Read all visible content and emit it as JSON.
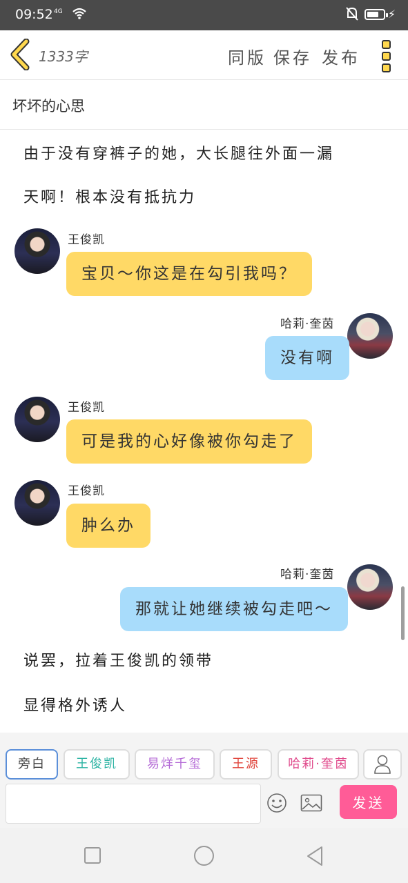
{
  "status_bar": {
    "time": "09:52",
    "signal": "4G",
    "icons": [
      "signal-icon",
      "wifi-icon",
      "mute-icon",
      "battery-icon"
    ]
  },
  "header": {
    "word_count": "1333字",
    "actions": [
      "同版",
      "保存",
      "发布"
    ]
  },
  "story": {
    "title": "坏坏的心思"
  },
  "content": {
    "narration_1": "由于没有穿裤子的她，大长腿往外面一漏",
    "narration_2": "天啊！根本没有抵抗力",
    "messages": [
      {
        "speaker": "王俊凯",
        "text": "宝贝～你这是在勾引我吗？",
        "side": "left"
      },
      {
        "speaker": "哈莉·奎茵",
        "text": "没有啊",
        "side": "right"
      },
      {
        "speaker": "王俊凯",
        "text": "可是我的心好像被你勾走了",
        "side": "left"
      },
      {
        "speaker": "王俊凯",
        "text": "肿么办",
        "side": "left"
      },
      {
        "speaker": "哈莉·奎茵",
        "text": "那就让她继续被勾走吧～",
        "side": "right"
      }
    ],
    "narration_3": "说罢，拉着王俊凯的领带",
    "narration_4": "显得格外诱人"
  },
  "composer": {
    "roles": [
      "旁白",
      "王俊凯",
      "易烊千玺",
      "王源",
      "哈莉·奎茵"
    ],
    "input_value": "",
    "send_label": "发送"
  },
  "colors": {
    "bubble_left": "#ffd966",
    "bubble_right": "#a8dcfb",
    "send": "#ff5c97",
    "accent_yellow": "#ffd84e"
  }
}
